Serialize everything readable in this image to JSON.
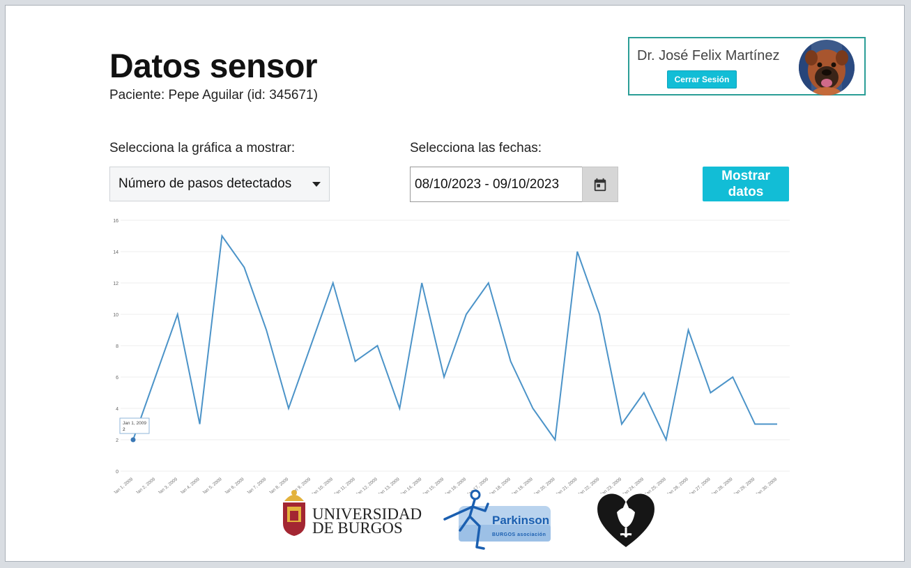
{
  "page": {
    "title": "Datos sensor",
    "patient": "Paciente: Pepe Aguilar (id: 345671)"
  },
  "user": {
    "name": "Dr. José Felix Martínez",
    "logout_label": "Cerrar Sesión",
    "card_border_color": "#2a9d96"
  },
  "controls": {
    "chart_label": "Selecciona la gráfica a mostrar:",
    "chart_selected": "Número de pasos detectados",
    "dates_label": "Selecciona las fechas:",
    "date_range": "08/10/2023 - 09/10/2023",
    "show_button": "Mostrar datos",
    "calendar_icon": "calendar-icon",
    "accent_color": "#12bdd6"
  },
  "chart_data": {
    "type": "line",
    "categories": [
      "Jan 1, 2009",
      "Jan 2, 2009",
      "Jan 3, 2009",
      "Jan 4, 2009",
      "Jan 5, 2009",
      "Jan 6, 2009",
      "Jan 7, 2009",
      "Jan 8, 2009",
      "Jan 9, 2009",
      "Jan 10, 2009",
      "Jan 11, 2009",
      "Jan 12, 2009",
      "Jan 13, 2009",
      "Jan 14, 2009",
      "Jan 15, 2009",
      "Jan 16, 2009",
      "Jan 17, 2009",
      "Jan 18, 2009",
      "Jan 19, 2009",
      "Jan 20, 2009",
      "Jan 21, 2009",
      "Jan 22, 2009",
      "Jan 23, 2009",
      "Jan 24, 2009",
      "Jan 25, 2009",
      "Jan 26, 2009",
      "Jan 27, 2009",
      "Jan 28, 2009",
      "Jan 29, 2009",
      "Jan 30, 2009"
    ],
    "values": [
      2,
      6,
      10,
      3,
      15,
      13,
      9,
      4,
      8,
      12,
      7,
      8,
      4,
      12,
      6,
      10,
      12,
      7,
      4,
      2,
      14,
      10,
      3,
      5,
      2,
      9,
      5,
      6,
      3,
      3
    ],
    "yticks": [
      0,
      2,
      4,
      6,
      8,
      10,
      12,
      14,
      16
    ],
    "ylim": [
      0,
      16
    ],
    "grid": true,
    "line_color": "#4b93c8",
    "tooltip": {
      "date": "Jan 1, 2009",
      "value": "2"
    }
  },
  "logos": {
    "university_line1": "UNIVERSIDAD",
    "university_line2": "DE BURGOS",
    "parkinson_name": "Parkinson",
    "parkinson_sub": "BURGOS asociación"
  }
}
